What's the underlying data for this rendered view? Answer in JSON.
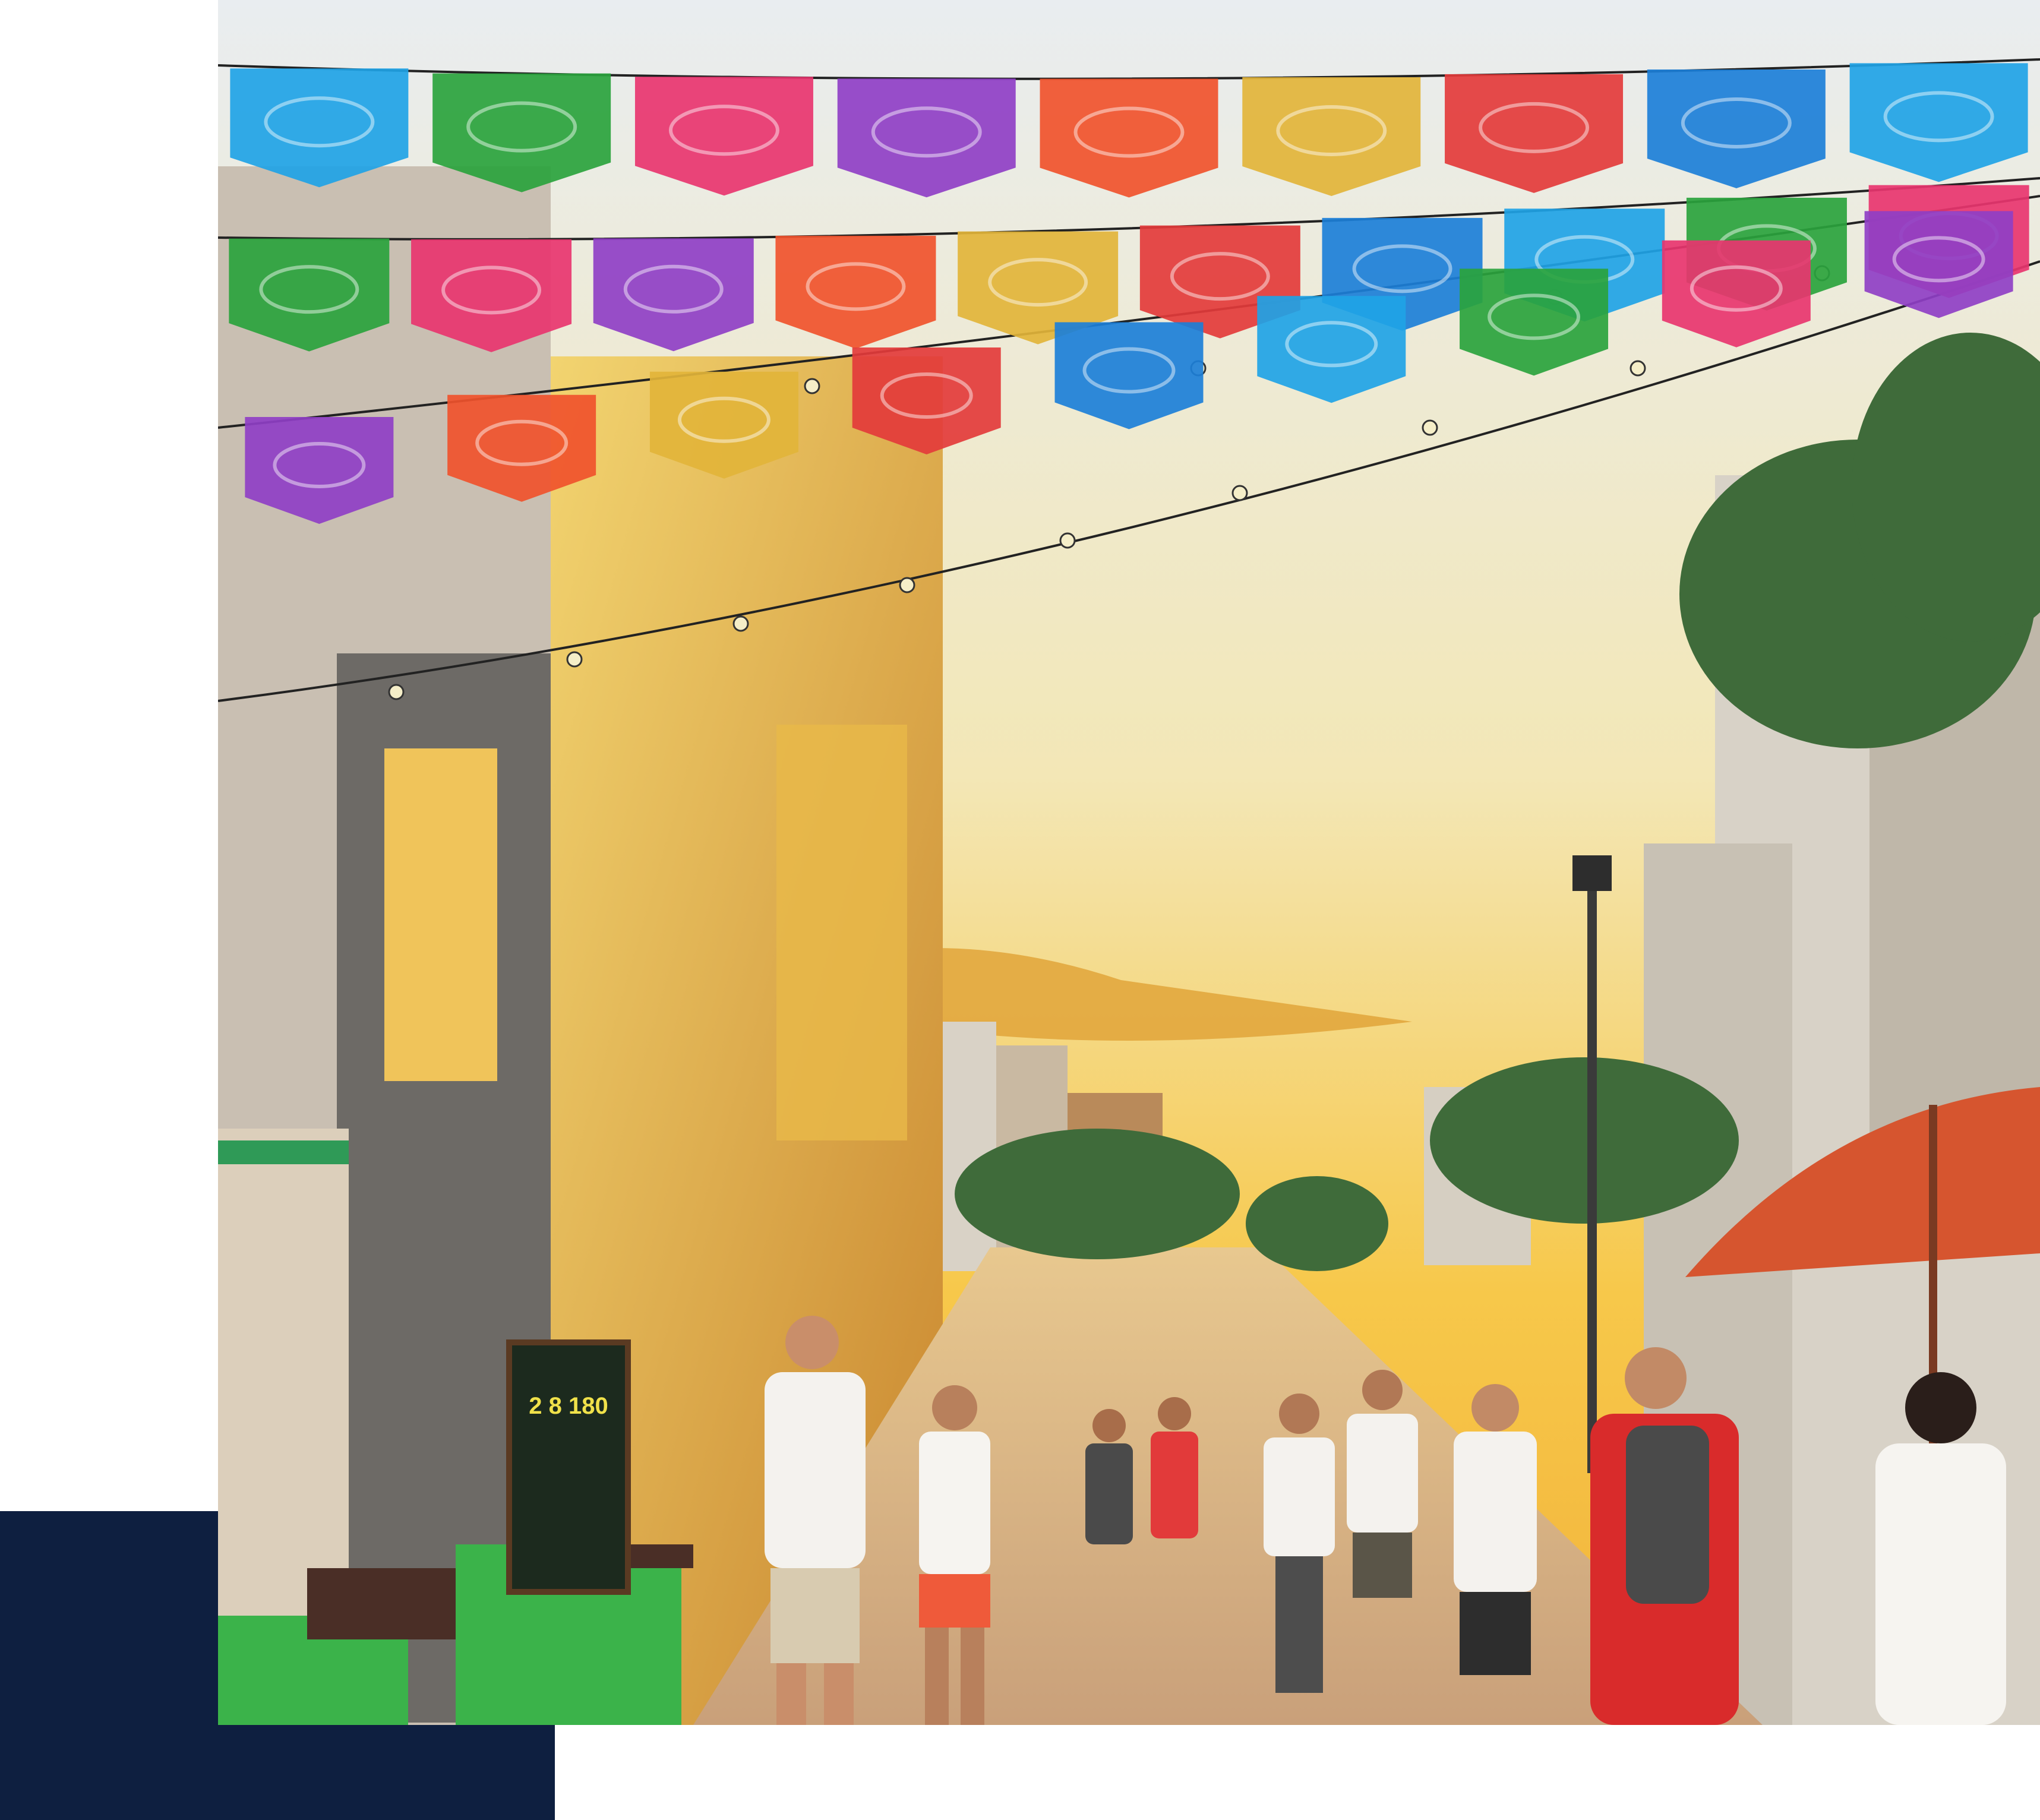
{
  "layout": {
    "accent_block_color": "#0e1f40",
    "background_color": "#ffffff"
  },
  "photo": {
    "subject": "street-scene",
    "colors": {
      "sky_top": "#e9edf0",
      "sky_mid": "#f3e7b6",
      "sky_sunset": "#f7c84a",
      "cloud": "#e0a43a",
      "street": "#d9b98f",
      "building_left": "#c9bfb2",
      "glass_facade": "#e5b94c",
      "umbrella": "#d6552f",
      "palm": "#3f6b3a"
    },
    "banner_colors": [
      "#1fa3e6",
      "#2aa33d",
      "#e8356f",
      "#8f3fc6",
      "#f0532c",
      "#e2b43a",
      "#e33b3b",
      "#1c7fd8"
    ],
    "signs": {
      "chalkboard": "2 8 180"
    }
  }
}
